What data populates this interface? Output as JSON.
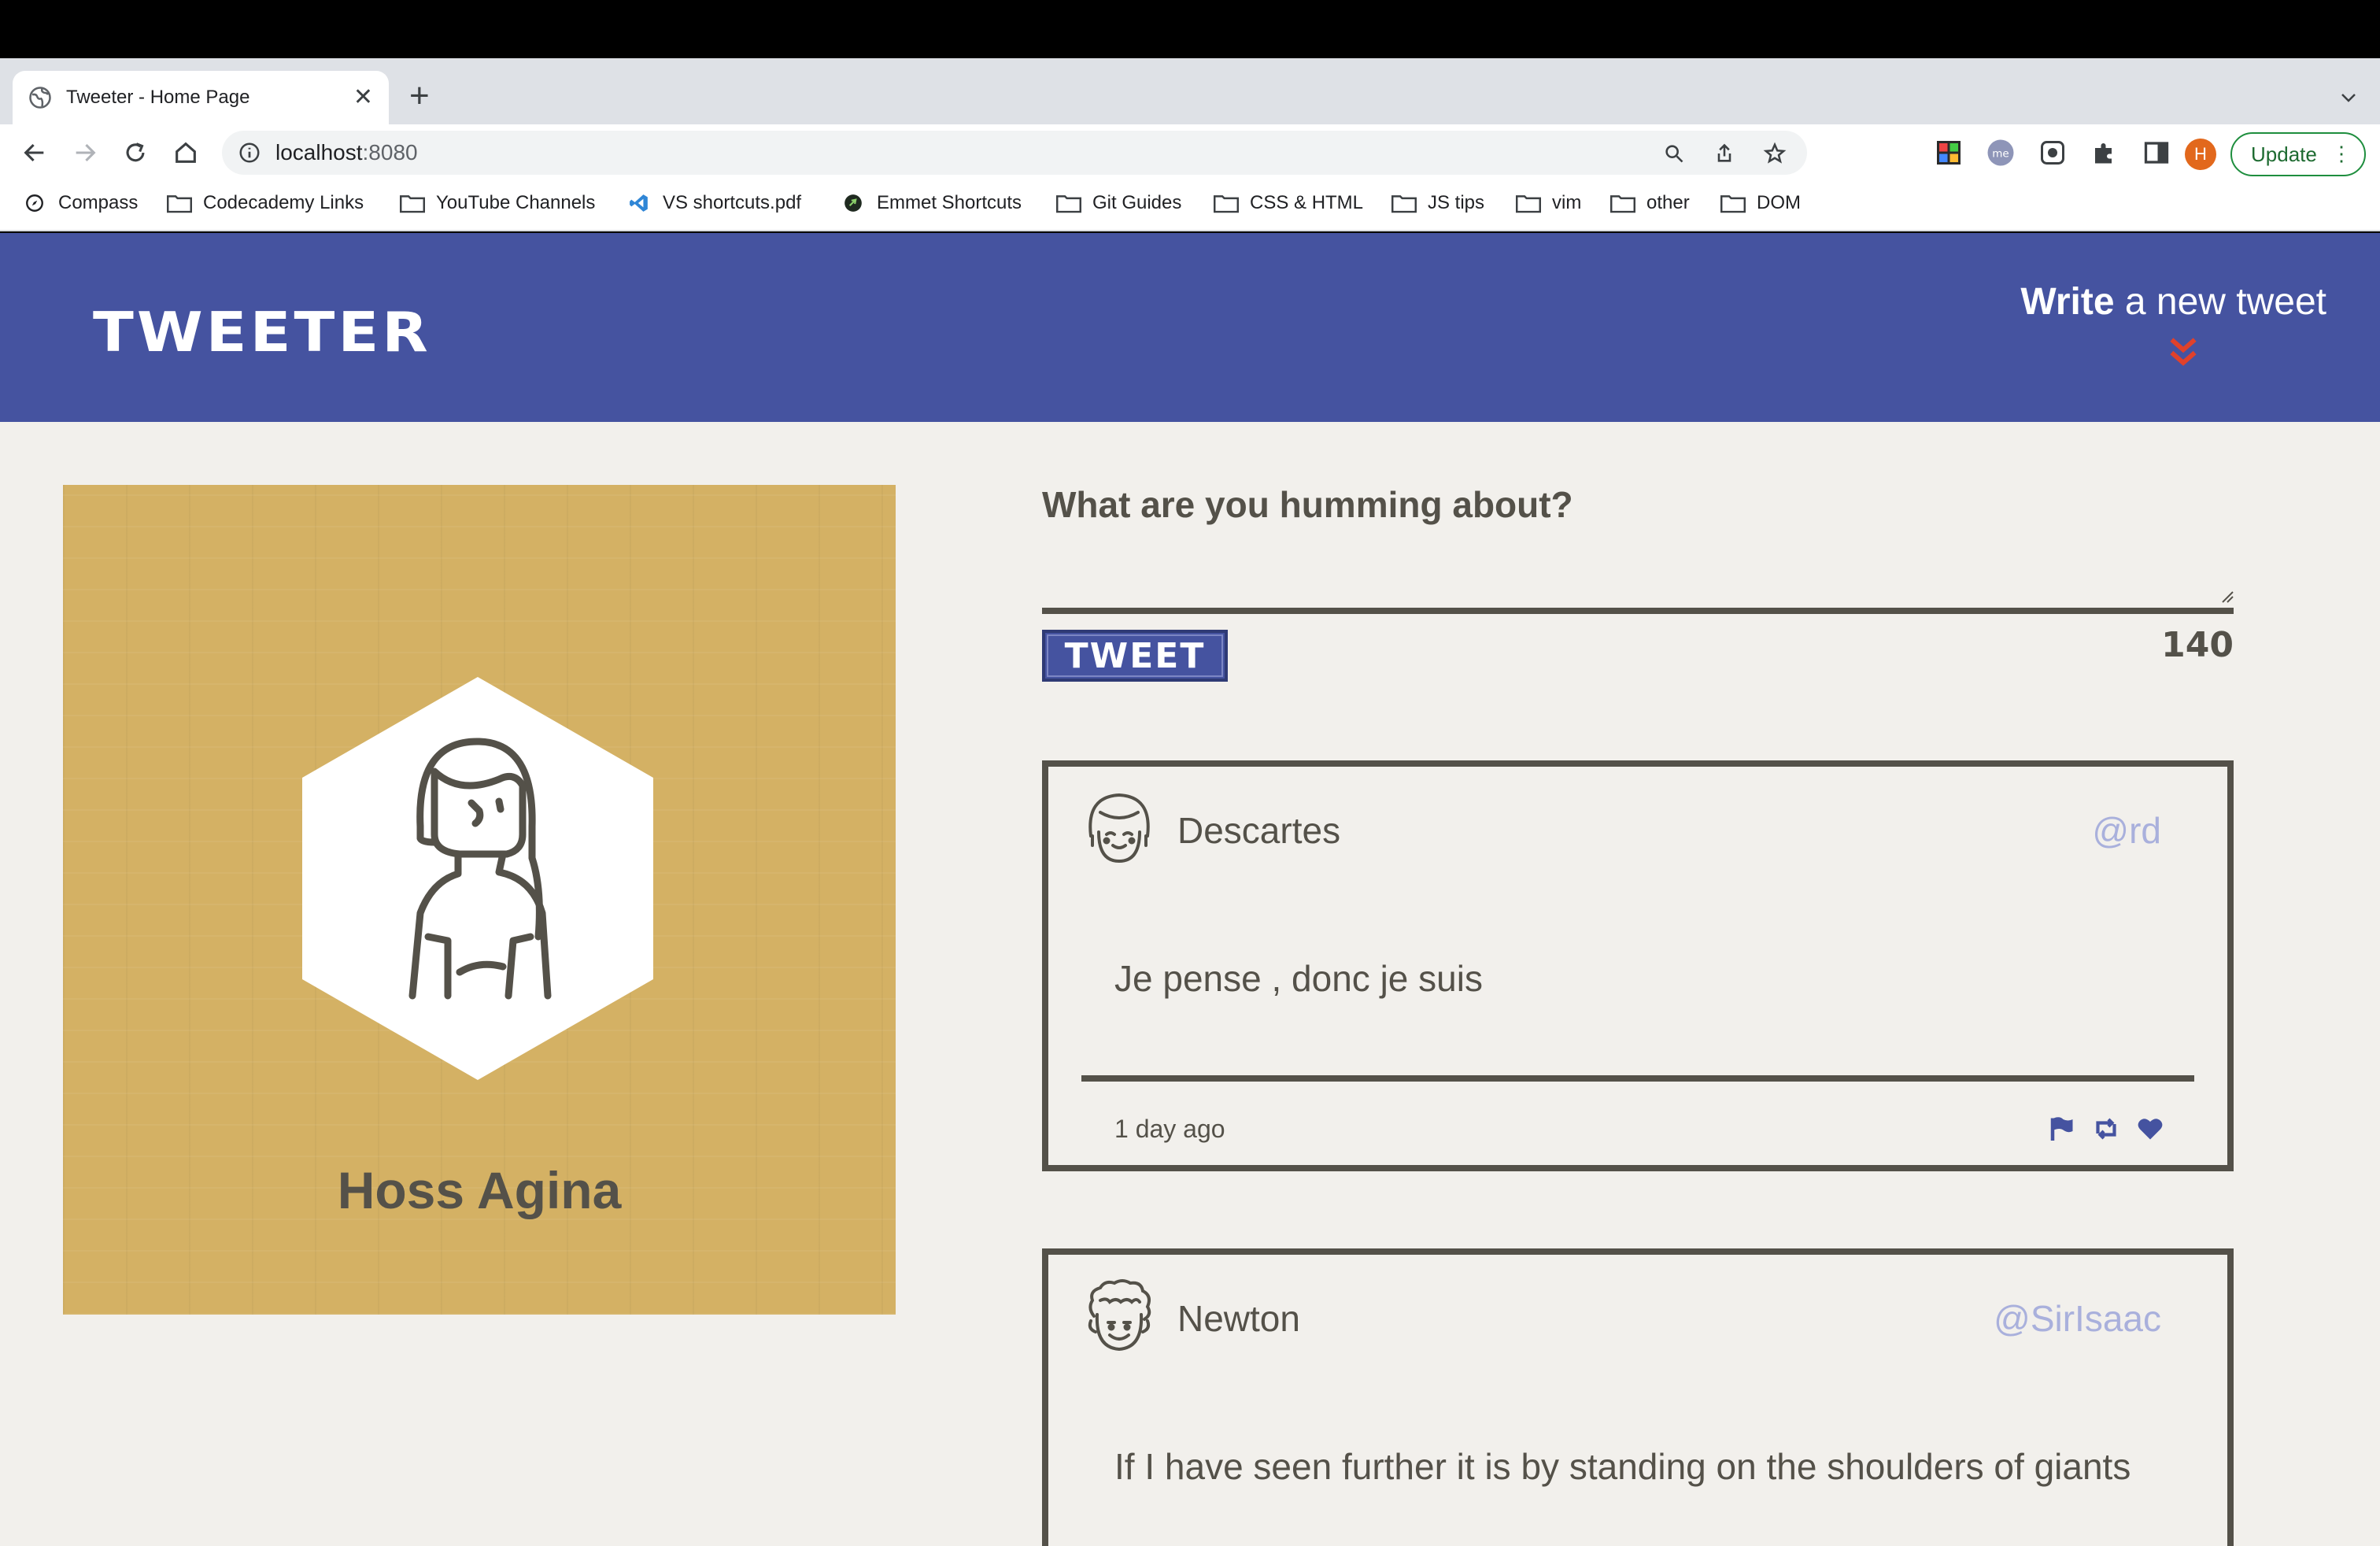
{
  "browser": {
    "tab_title": "Tweeter - Home Page",
    "url_host": "localhost",
    "url_port": ":8080",
    "update_label": "Update",
    "avatar_initial": "H",
    "bookmarks": [
      {
        "label": "Compass",
        "icon": "compass-icon"
      },
      {
        "label": "Codecademy Links",
        "icon": "folder-icon"
      },
      {
        "label": "YouTube Channels",
        "icon": "folder-icon"
      },
      {
        "label": "VS shortcuts.pdf",
        "icon": "vscode-icon"
      },
      {
        "label": "Emmet Shortcuts",
        "icon": "emmet-icon"
      },
      {
        "label": "Git Guides",
        "icon": "folder-icon"
      },
      {
        "label": "CSS & HTML",
        "icon": "folder-icon"
      },
      {
        "label": "JS tips",
        "icon": "folder-icon"
      },
      {
        "label": "vim",
        "icon": "folder-icon"
      },
      {
        "label": "other",
        "icon": "folder-icon"
      },
      {
        "label": "DOM",
        "icon": "folder-icon"
      }
    ]
  },
  "header": {
    "logo": "TWEETER",
    "write_bold": "Write",
    "write_rest": " a new tweet"
  },
  "profile": {
    "name": "Hoss Agina"
  },
  "compose": {
    "label": "What are you humming about?",
    "value": "",
    "button_label": "TWEET",
    "counter": "140"
  },
  "tweets": [
    {
      "name": "Descartes",
      "handle": "@rd",
      "text": "Je pense , donc je suis",
      "time": "1 day ago"
    },
    {
      "name": "Newton",
      "handle": "@SirIsaac",
      "text": "If I have seen further it is by standing on the shoulders of giants"
    }
  ],
  "colors": {
    "header_bg": "#4553a0",
    "page_bg": "#f2f0ec",
    "profile_bg": "#d4b164",
    "text_dark": "#545149",
    "handle": "#a9b0dc",
    "accent_red": "#e0412b"
  }
}
